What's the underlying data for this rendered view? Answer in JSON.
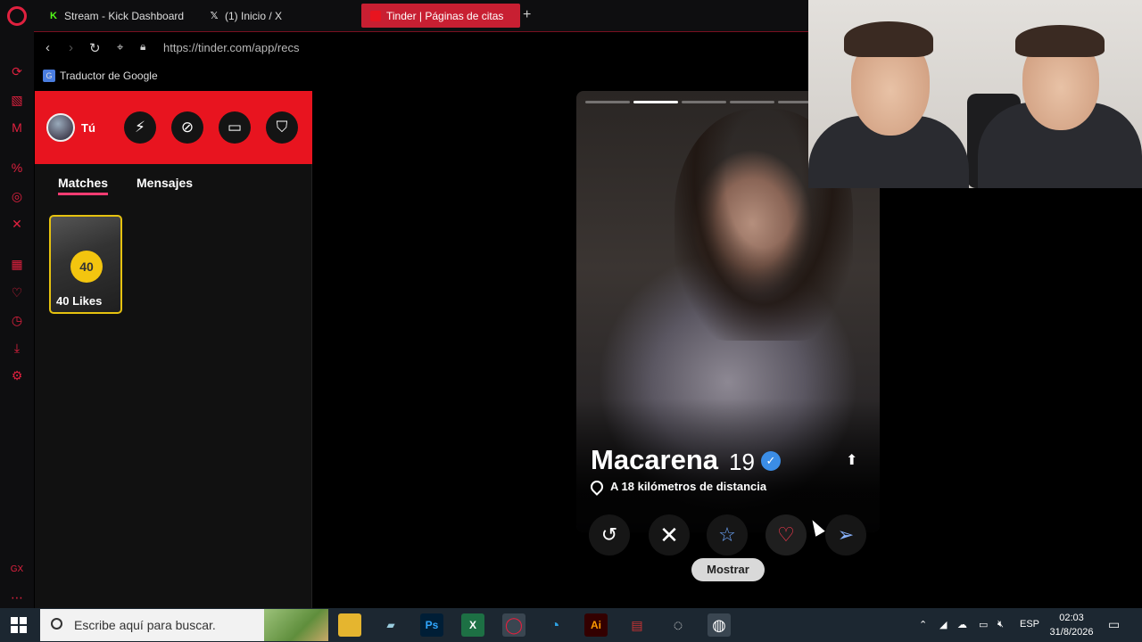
{
  "browser": {
    "tabs": [
      {
        "label": "Stream - Kick Dashboard",
        "icon": "kick-icon"
      },
      {
        "label": "(1) Inicio / X",
        "icon": "x-icon"
      },
      {
        "label": "Tinder | Páginas de citas",
        "icon": "tinder-icon"
      }
    ],
    "new_tab": "+",
    "url": "https://tinder.com/app/recs",
    "bookmark": "Traductor de Google"
  },
  "sidebar": {
    "user_label": "Tú",
    "tabs": [
      {
        "label": "Matches"
      },
      {
        "label": "Mensajes"
      }
    ],
    "likes": {
      "count": "40",
      "label": "40 Likes"
    }
  },
  "profile": {
    "name": "Macarena",
    "age": "19",
    "distance": "A 18 kilómetros de distancia",
    "photo_index": 2,
    "photo_count": 6
  },
  "actions": {
    "tooltip": "Mostrar"
  },
  "taskbar": {
    "search_placeholder": "Escribe aquí para buscar.",
    "language": "ESP",
    "time": "02:03",
    "date": "31/8/2026"
  },
  "colors": {
    "tinder_red": "#e8141f",
    "opera_red": "#e0213f",
    "likes_gold": "#f3c50f"
  }
}
